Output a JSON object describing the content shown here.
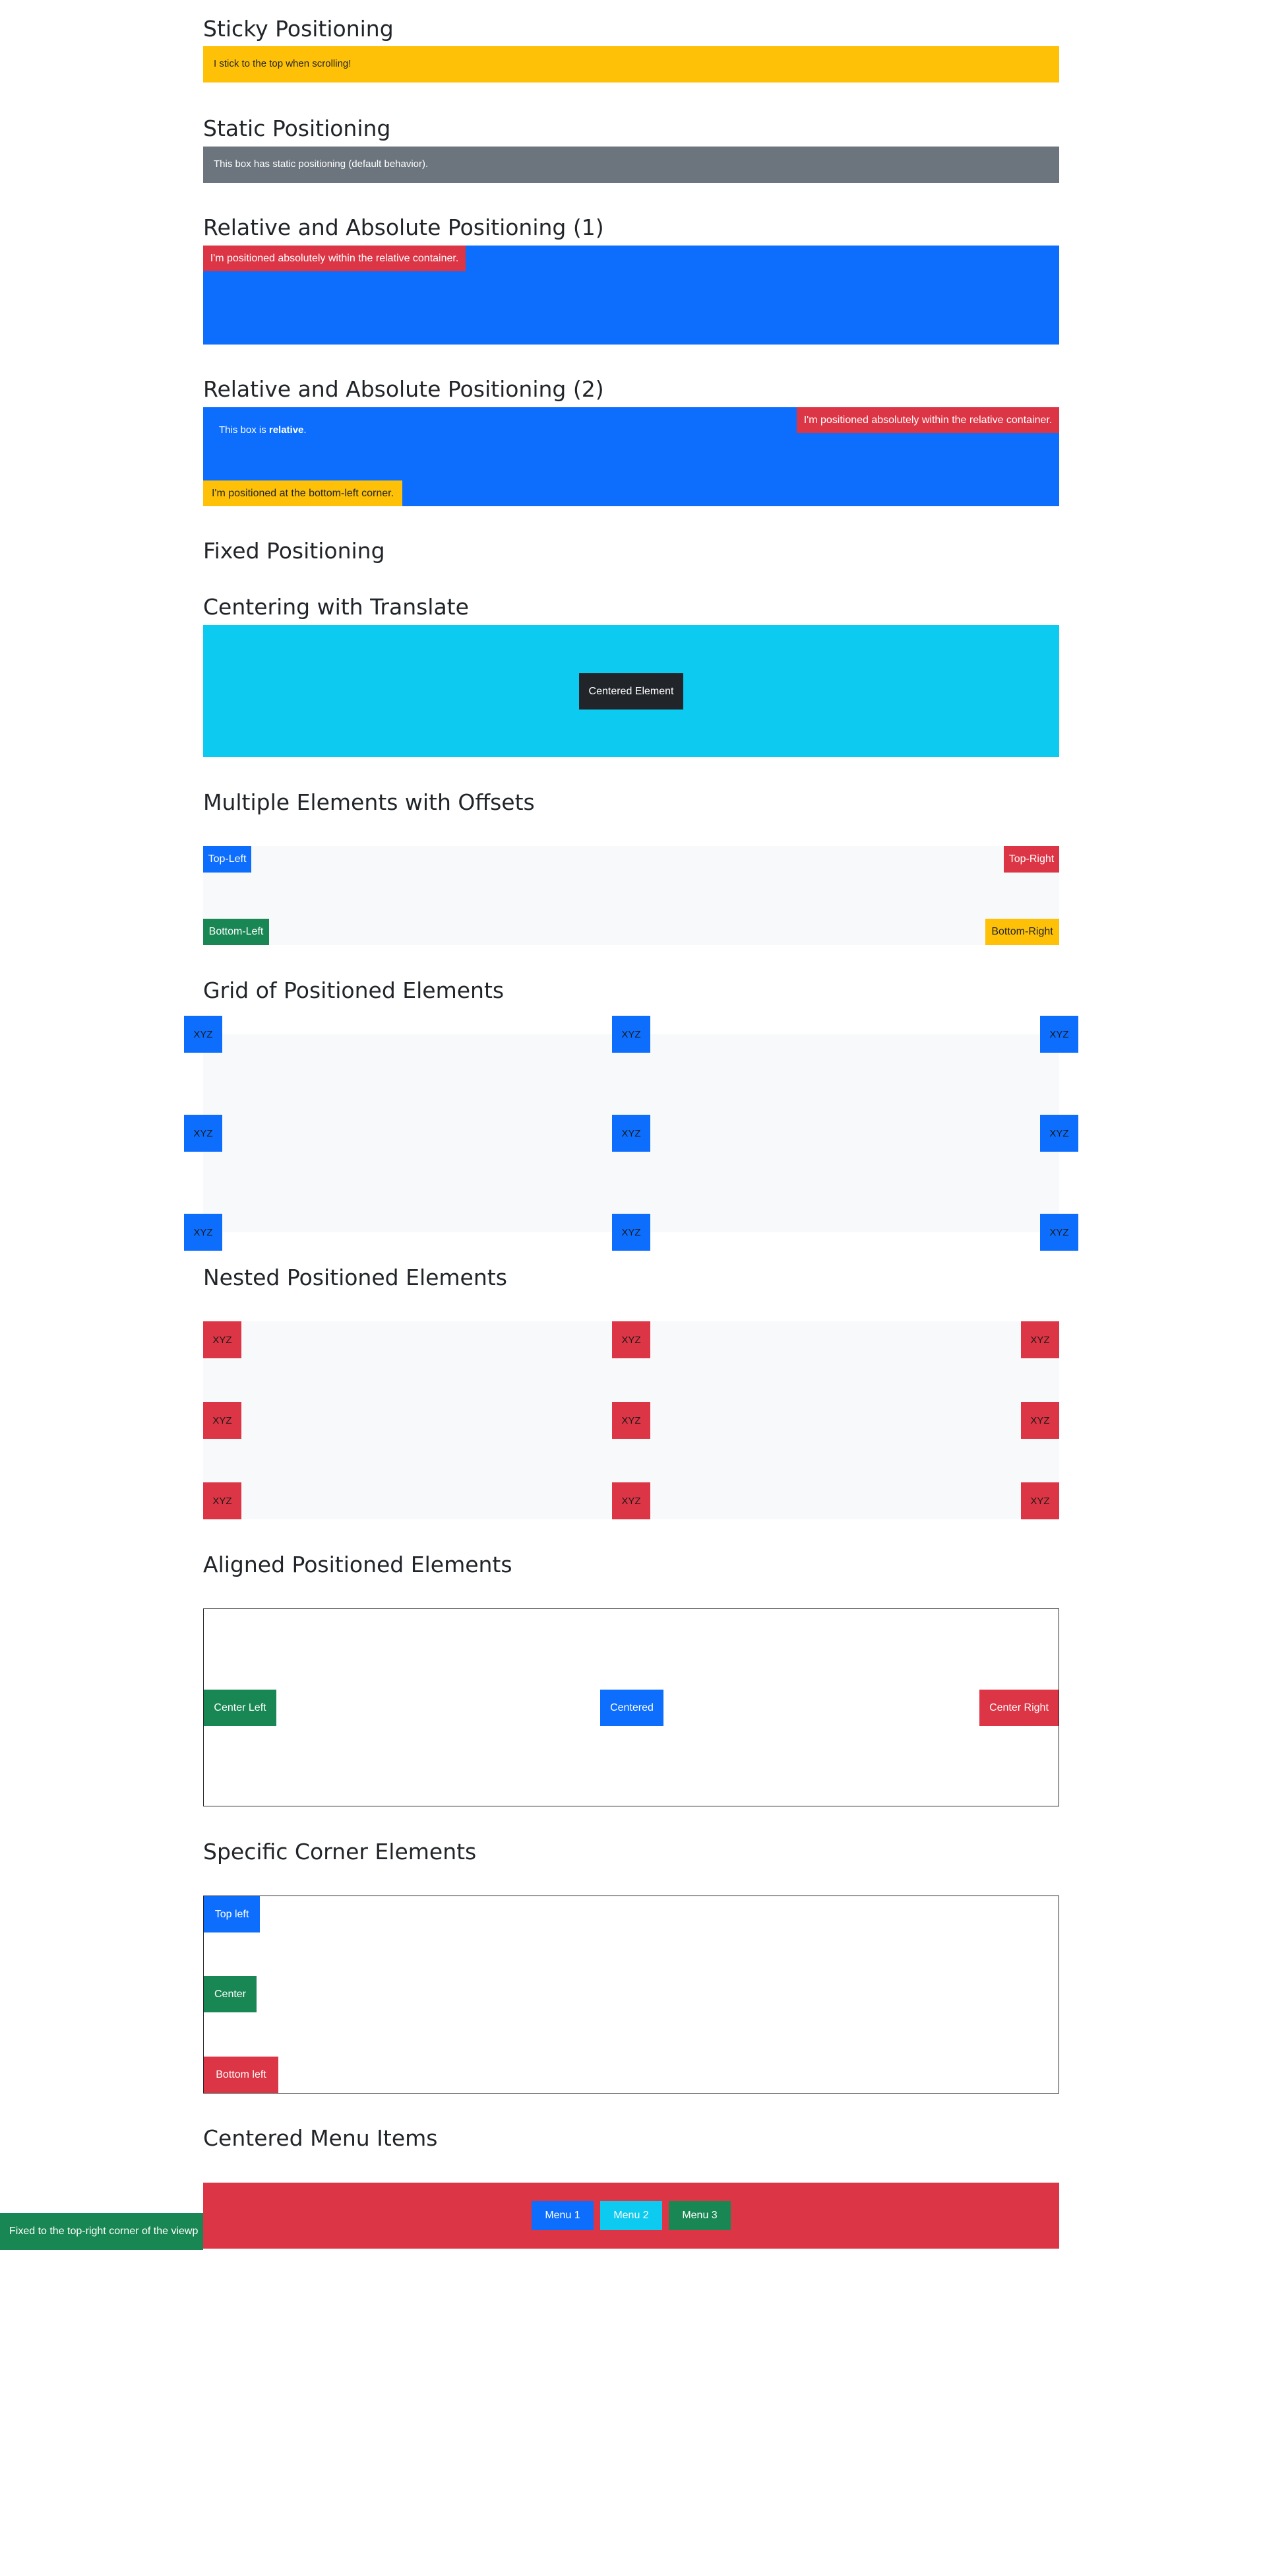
{
  "sticky": {
    "heading": "Sticky Positioning",
    "text": "I stick to the top when scrolling!"
  },
  "static": {
    "heading": "Static Positioning",
    "text": "This box has static positioning (default behavior)."
  },
  "rel_abs_1": {
    "heading": "Relative and Absolute Positioning (1)",
    "abs_text": "I'm positioned absolutely within the relative container."
  },
  "rel_abs_2": {
    "heading": "Relative and Absolute Positioning (2)",
    "rel_text_prefix": "This box is ",
    "rel_text_bold": "relative",
    "rel_text_suffix": ".",
    "abs_text": "I'm positioned absolutely within the relative container.",
    "bottom_left_text": "I'm positioned at the bottom-left corner."
  },
  "fixed": {
    "heading": "Fixed Positioning",
    "fixed_text": "Fixed to the top-right corner of the viewp"
  },
  "centering": {
    "heading": "Centering with Translate",
    "centered_label": "Centered Element"
  },
  "offsets": {
    "heading": "Multiple Elements with Offsets",
    "top_left": "Top-Left",
    "top_right": "Top-Right",
    "bottom_left": "Bottom-Left",
    "bottom_right": "Bottom-Right"
  },
  "grid": {
    "heading": "Grid of Positioned Elements",
    "cell_label": "XYZ"
  },
  "nested": {
    "heading": "Nested Positioned Elements",
    "cell_label": "XYZ"
  },
  "aligned": {
    "heading": "Aligned Positioned Elements",
    "center_left": "Center Left",
    "centered": "Centered",
    "center_right": "Center Right"
  },
  "corners": {
    "heading": "Specific Corner Elements",
    "top_left": "Top left",
    "center": "Center",
    "bottom_left": "Bottom left"
  },
  "menu": {
    "heading": "Centered Menu Items",
    "items": [
      "Menu 1",
      "Menu 2",
      "Menu 3"
    ]
  },
  "colors": {
    "primary": "#0d6efd",
    "danger": "#dc3545",
    "success": "#198754",
    "warning": "#ffc107",
    "info": "#0dcaf0",
    "dark": "#212529",
    "secondary": "#6c757d",
    "light": "#f8f9fa"
  }
}
